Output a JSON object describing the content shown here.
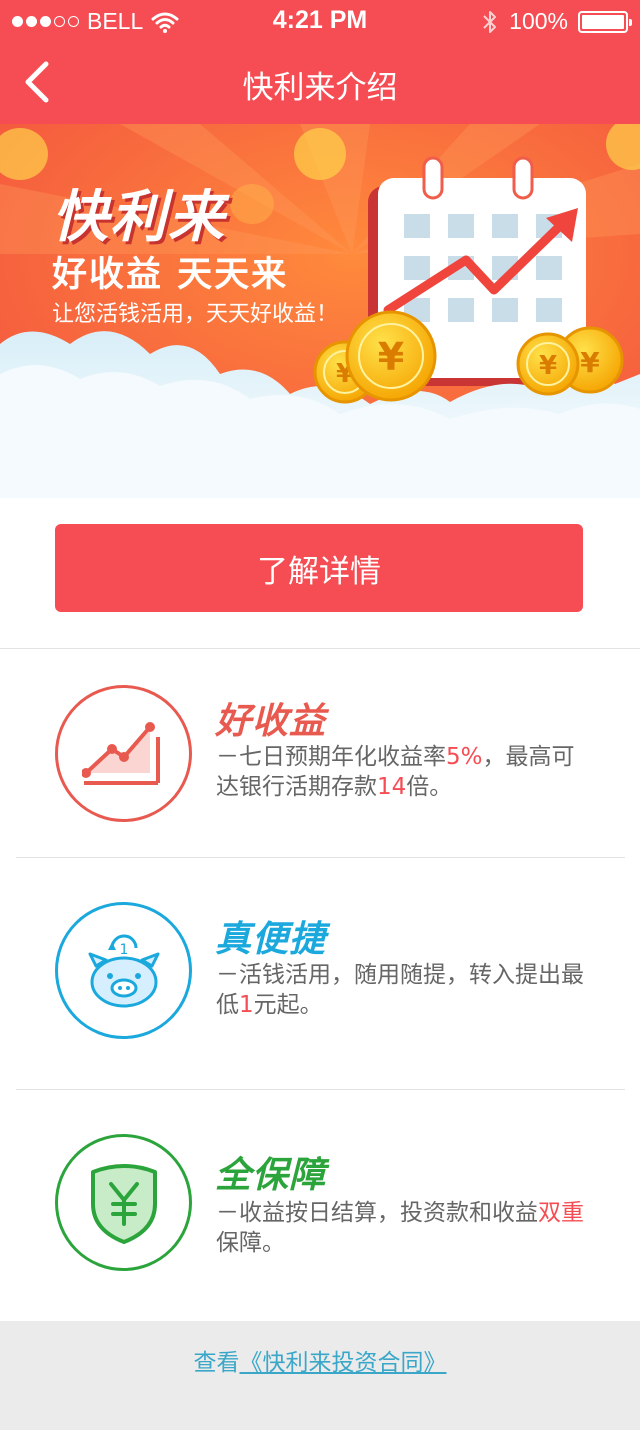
{
  "status_bar": {
    "carrier": "BELL",
    "signal_dots_filled": 3,
    "time": "4:21 PM",
    "battery": "100%"
  },
  "nav": {
    "title": "快利来介绍",
    "back_icon": "chevron-left-icon"
  },
  "banner": {
    "brand": "快利来",
    "slogan": "好收益 天天来",
    "tagline": "让您活钱活用，天天好收益！",
    "illustration": "calendar-growth-arrow-coins"
  },
  "cta": {
    "label": "了解详情"
  },
  "features": [
    {
      "icon": "line-chart-icon",
      "color": "#e85a4f",
      "title": "好收益",
      "desc_parts": [
        "－七日预期年化收益率",
        "5%",
        "，最高可达银行活期存款",
        "14",
        "倍。"
      ]
    },
    {
      "icon": "piggy-bank-icon",
      "color": "#1aa8dd",
      "title": "真便捷",
      "desc_parts": [
        "－活钱活用，随用随提，转入提出最低",
        "1",
        "元起。"
      ]
    },
    {
      "icon": "shield-yuan-icon",
      "color": "#2ca43c",
      "title": "全保障",
      "desc_parts": [
        "－收益按日结算，投资款和收益",
        "双重",
        "保障。"
      ]
    }
  ],
  "footer": {
    "prefix": "查看",
    "link": "《快利来投资合同》"
  },
  "colors": {
    "primary_red": "#f54d53",
    "highlight_red": "#f54d53",
    "link_blue": "#3aa7c8",
    "footer_bg": "#ebebeb"
  }
}
